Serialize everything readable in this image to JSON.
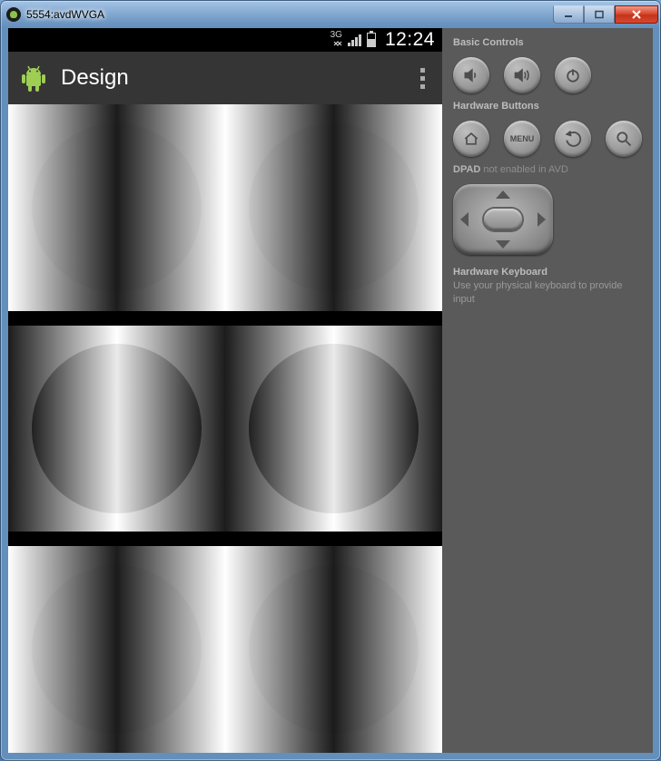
{
  "window": {
    "title": "5554:avdWVGA",
    "buttons": {
      "minimize": "minimize",
      "maximize": "maximize",
      "close": "close"
    }
  },
  "device": {
    "statusbar": {
      "network": "3G",
      "clock": "12:24"
    },
    "actionbar": {
      "title": "Design",
      "overflow_label": "More options"
    }
  },
  "panel": {
    "sections": {
      "basic": "Basic Controls",
      "hardware": "Hardware Buttons",
      "dpad_label": "DPAD",
      "dpad_status": "not enabled in AVD",
      "keyboard_title": "Hardware Keyboard",
      "keyboard_hint": "Use your physical keyboard to provide input"
    },
    "buttons": {
      "vol_down": "volume-down",
      "vol_up": "volume-up",
      "power": "power",
      "home": "home",
      "menu": "MENU",
      "back": "back",
      "search": "search"
    }
  }
}
